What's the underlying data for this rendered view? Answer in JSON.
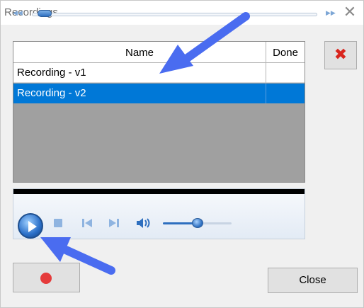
{
  "window": {
    "title": "Recordings"
  },
  "recordings_list": {
    "columns": [
      "Name",
      "Done"
    ],
    "rows": [
      {
        "name": "Recording - v1",
        "done": "",
        "selected": false
      },
      {
        "name": "Recording - v2",
        "done": "",
        "selected": true
      }
    ]
  },
  "buttons": {
    "close_label": "Close"
  },
  "icons": {
    "window_close": "close-icon",
    "delete": "delete-x-icon",
    "play": "play-icon",
    "stop": "stop-icon",
    "previous": "previous-track-icon",
    "next": "next-track-icon",
    "volume": "speaker-icon",
    "record": "record-dot-icon",
    "seek_back": "rewind-icon",
    "seek_forward": "fast-forward-icon"
  },
  "player": {
    "seek_position": 0.02,
    "volume_level": 0.5
  },
  "colors": {
    "selection": "#0078d7",
    "delete_x": "#d9251d",
    "record_dot": "#e53b3b",
    "annotation_arrow": "#4a6cf0"
  }
}
